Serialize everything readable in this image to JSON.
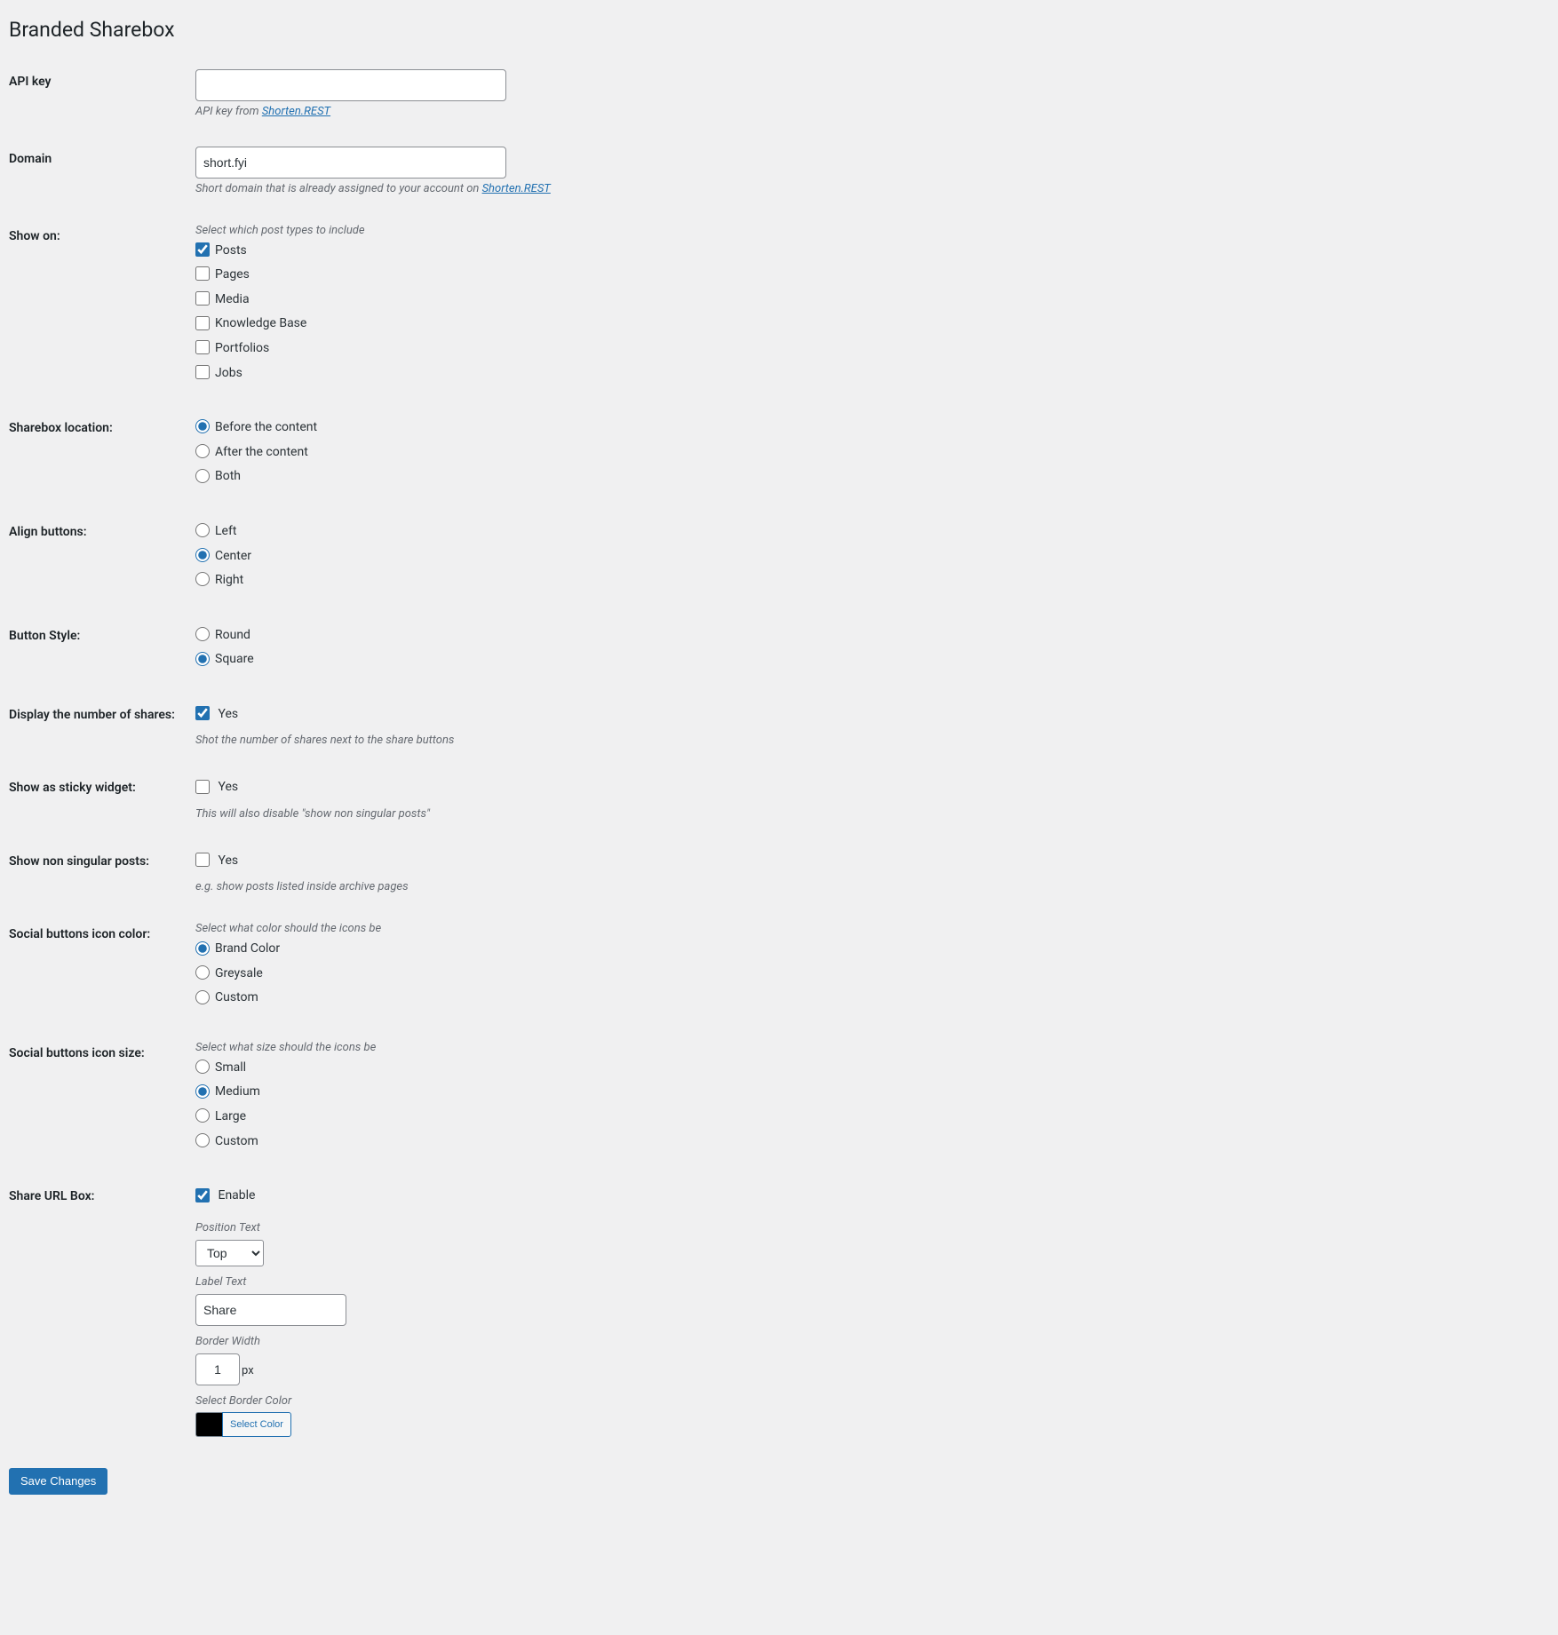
{
  "page_title": "Branded Sharebox",
  "api_key": {
    "label": "API key",
    "value": "",
    "help_prefix": "API key from ",
    "help_link": "Shorten.REST"
  },
  "domain": {
    "label": "Domain",
    "value": "short.fyi",
    "help_prefix": "Short domain that is already assigned to your account on ",
    "help_link": "Shorten.REST"
  },
  "show_on": {
    "label": "Show on:",
    "help": "Select which post types to include",
    "options": [
      {
        "label": "Posts",
        "checked": true
      },
      {
        "label": "Pages",
        "checked": false
      },
      {
        "label": "Media",
        "checked": false
      },
      {
        "label": "Knowledge Base",
        "checked": false
      },
      {
        "label": "Portfolios",
        "checked": false
      },
      {
        "label": "Jobs",
        "checked": false
      }
    ]
  },
  "sharebox_location": {
    "label": "Sharebox location:",
    "options": [
      {
        "label": "Before the content",
        "checked": true
      },
      {
        "label": "After the content",
        "checked": false
      },
      {
        "label": "Both",
        "checked": false
      }
    ]
  },
  "align_buttons": {
    "label": "Align buttons:",
    "options": [
      {
        "label": "Left",
        "checked": false
      },
      {
        "label": "Center",
        "checked": true
      },
      {
        "label": "Right",
        "checked": false
      }
    ]
  },
  "button_style": {
    "label": "Button Style:",
    "options": [
      {
        "label": "Round",
        "checked": false
      },
      {
        "label": "Square",
        "checked": true
      }
    ]
  },
  "display_shares": {
    "label": "Display the number of shares:",
    "option_label": "Yes",
    "checked": true,
    "help": "Shot the number of shares next to the share buttons"
  },
  "sticky_widget": {
    "label": "Show as sticky widget:",
    "option_label": "Yes",
    "checked": false,
    "help": "This will also disable \"show non singular posts\""
  },
  "non_singular": {
    "label": "Show non singular posts:",
    "option_label": "Yes",
    "checked": false,
    "help": "e.g. show posts listed inside archive pages"
  },
  "icon_color": {
    "label": "Social buttons icon color:",
    "help": "Select what color should the icons be",
    "options": [
      {
        "label": "Brand Color",
        "checked": true
      },
      {
        "label": "Greysale",
        "checked": false
      },
      {
        "label": "Custom",
        "checked": false
      }
    ]
  },
  "icon_size": {
    "label": "Social buttons icon size:",
    "help": "Select what size should the icons be",
    "options": [
      {
        "label": "Small",
        "checked": false
      },
      {
        "label": "Medium",
        "checked": true
      },
      {
        "label": "Large",
        "checked": false
      },
      {
        "label": "Custom",
        "checked": false
      }
    ]
  },
  "share_url_box": {
    "label": "Share URL Box:",
    "enable_label": "Enable",
    "enable_checked": true,
    "position_text_label": "Position Text",
    "position_selected": "Top",
    "label_text_label": "Label Text",
    "label_text_value": "Share",
    "border_width_label": "Border Width",
    "border_width_value": "1",
    "px_suffix": "px",
    "select_border_color_label": "Select Border Color",
    "select_color_button": "Select Color",
    "swatch_color": "#000000"
  },
  "submit_label": "Save Changes"
}
